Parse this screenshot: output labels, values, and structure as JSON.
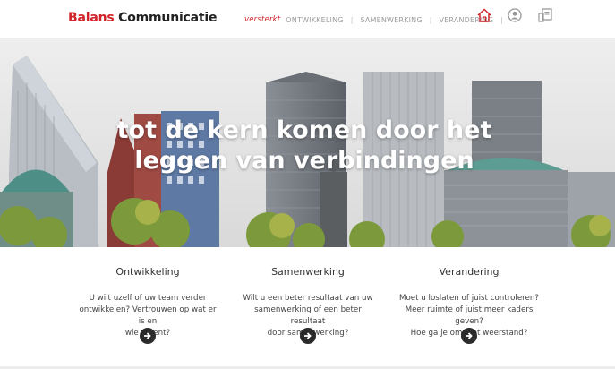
{
  "brand": {
    "part1": "Balans",
    "part2": "Communicatie"
  },
  "nav": {
    "tagline": "versterkt",
    "items": [
      "ONTWIKKELING",
      "SAMENWERKING",
      "VERANDERING"
    ]
  },
  "icons": [
    "home-icon",
    "user-icon",
    "document-icon"
  ],
  "colors": {
    "accent": "#d2232a",
    "nav_text": "#9a9a9a",
    "button": "#2b2b2b"
  },
  "hero": {
    "line1": "tot de kern komen door het",
    "line2": "leggen van verbindingen"
  },
  "features": [
    {
      "title": "Ontwikkeling",
      "lines": [
        "U wilt uzelf of uw team verder",
        "ontwikkelen? Vertrouwen op wat er is en",
        "wie u bent?"
      ]
    },
    {
      "title": "Samenwerking",
      "lines": [
        "Wilt u een beter resultaat van uw",
        "samenwerking of een beter resultaat",
        "door samenwerking?"
      ]
    },
    {
      "title": "Verandering",
      "lines": [
        "Moet u loslaten of juist controleren?",
        "Meer ruimte of juist meer kaders geven?",
        "Hoe ga je om met weerstand?"
      ]
    }
  ]
}
